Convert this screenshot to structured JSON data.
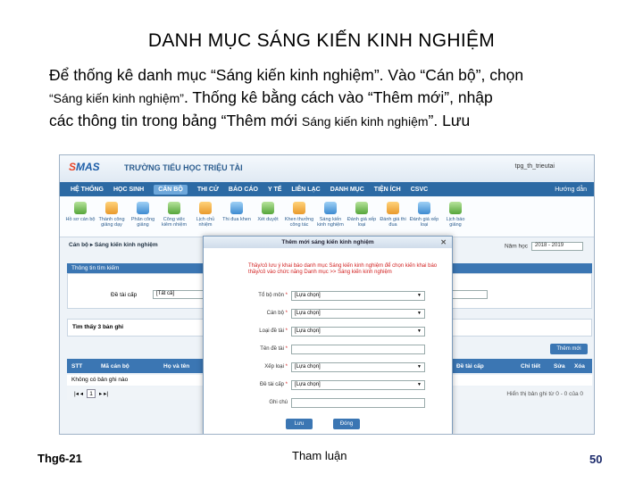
{
  "slide": {
    "title": "DANH MỤC SÁNG KIẾN KINH NGHIỆM",
    "para_line1": "Để thống kê danh mục “Sáng kiến kinh nghiệm”. Vào “Cán bộ”, chọn",
    "para_line2a": "“Sáng kiến kinh nghiệm”",
    "para_line2b": ". Thống kê bằng cách vào “Thêm mới”, nhập",
    "para_line3a": "các thông tin trong bảng “Thêm mới ",
    "para_line3b": "Sáng kiến kinh nghiệm",
    "para_line3c": "”. Lưu",
    "footer_left": "Thg6-21",
    "footer_mid": "Tham luận",
    "footer_right": "50"
  },
  "app": {
    "logo_s": "S",
    "logo_rest": "MAS",
    "school": "TRƯỜNG TIỂU HỌC TRIỆU TÀI",
    "user": "tpg_th_trieutai",
    "nav": [
      "HỆ THỐNG",
      "HỌC SINH",
      "CÁN BỘ",
      "THI CỬ",
      "BÁO CÁO",
      "Y TẾ",
      "LIÊN LẠC",
      "DANH MỤC",
      "TIỆN ÍCH",
      "CSVC"
    ],
    "nav_right": "Hướng dẫn",
    "tools": [
      "Hồ sơ cán bộ",
      "Thành công giảng dạy",
      "Phân công giảng",
      "Công việc kiêm nhiệm",
      "Lịch chủ nhiệm",
      "Thi đua khen",
      "Xét duyệt",
      "Khen thưởng công tác",
      "Sáng kiến kinh nghiệm",
      "Đánh giá xếp loại",
      "Đánh giá thi đua",
      "Đánh giá xếp loại",
      "Lịch báo giảng"
    ],
    "breadcrumb": "Cán bộ ▸ Sáng kiến kinh nghiệm",
    "year_label": "Năm học",
    "year_value": "2018 - 2019",
    "panel_title": "Thông tin tìm kiếm",
    "filter_label": "Đề tài cấp",
    "filter_value": "[Tất cả]",
    "found": "Tìm thấy 3 bản ghi",
    "add_button": "Thêm mới",
    "columns": [
      "STT",
      "Mã cán bộ",
      "Họ và tên",
      "Đề tài cấp",
      "Chi tiết",
      "Sửa",
      "Xóa"
    ],
    "empty_row": "Không có bản ghi nào",
    "page": "1",
    "page_info": "Hiển thị bản ghi từ 0 - 0 của 0"
  },
  "dialog": {
    "title": "Thêm mới sáng kiến kinh nghiệm",
    "close": "✕",
    "warning": "Thầy/cô lưu ý khai báo danh mục Sáng kiến kinh nghiệm để chọn kiến khai báo thầy/cô vào chức năng Danh mục >> Sáng kiến kinh nghiệm",
    "fields": [
      {
        "label": "Tổ bộ môn",
        "required": true,
        "value": "[Lựa chọn]"
      },
      {
        "label": "Cán bộ",
        "required": true,
        "value": "[Lựa chọn]"
      },
      {
        "label": "Loại đề tài",
        "required": true,
        "value": "[Lựa chọn]"
      },
      {
        "label": "Tên đề tài",
        "required": true,
        "value": ""
      },
      {
        "label": "Xếp loại",
        "required": true,
        "value": "[Lựa chọn]"
      },
      {
        "label": "Đề tài cấp",
        "required": true,
        "value": "[Lựa chọn]"
      },
      {
        "label": "Ghi chú",
        "required": false,
        "value": ""
      }
    ],
    "save": "Lưu",
    "close_button": "Đóng"
  }
}
